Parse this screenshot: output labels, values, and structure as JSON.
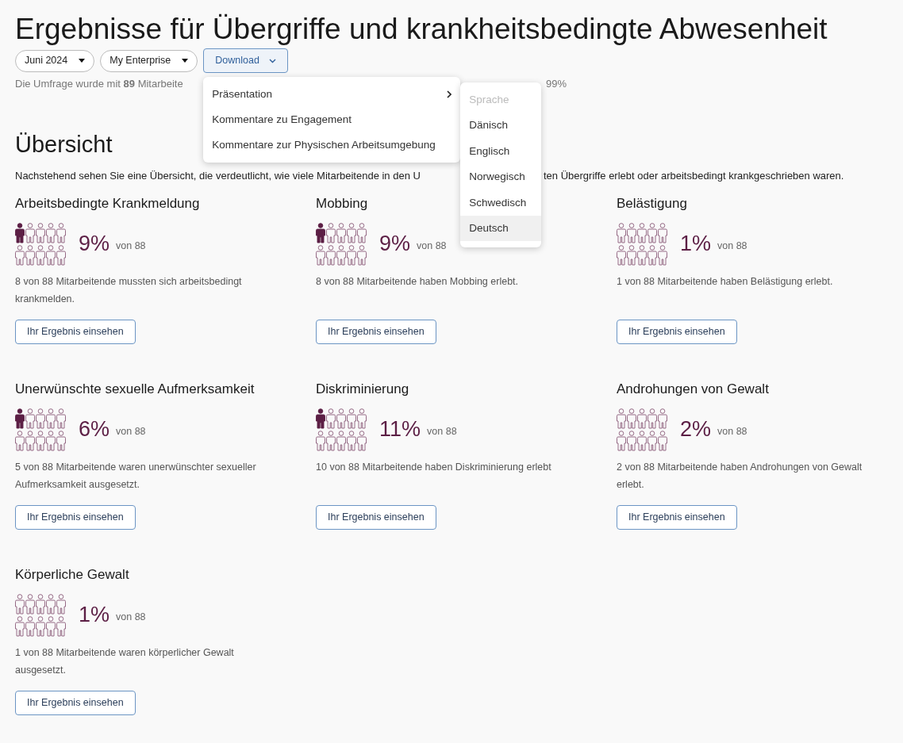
{
  "title": "Ergebnisse für Übergriffe und krankheitsbedingte Abwesenheit",
  "filters": [
    {
      "label": "Juni 2024"
    },
    {
      "label": "My Enterprise"
    }
  ],
  "download": {
    "label": "Download",
    "expanded": true
  },
  "subtitle": {
    "visible_start": "Die Umfrage wurde mit **89** Mitarbeite",
    "visible_end": "99%"
  },
  "download_menu": [
    {
      "label": "Präsentation",
      "kind": "submenu",
      "expanded": true
    },
    {
      "label": "Kommentare zu Engagement",
      "kind": "item"
    },
    {
      "label": "Kommentare zur Physischen Arbeitsumgebung",
      "kind": "item"
    }
  ],
  "language_menu": [
    {
      "label": "Sprache",
      "disabled": true,
      "selected": false
    },
    {
      "label": "Dänisch",
      "disabled": false,
      "selected": false
    },
    {
      "label": "Englisch",
      "disabled": false,
      "selected": false
    },
    {
      "label": "Norwegisch",
      "disabled": false,
      "selected": false
    },
    {
      "label": "Schwedisch",
      "disabled": false,
      "selected": false
    },
    {
      "label": "Deutsch",
      "disabled": false,
      "selected": true
    }
  ],
  "overview": {
    "heading": "Übersicht",
    "description_start": "Nachstehend sehen Sie eine Übersicht, die verdeutlicht, wie viele Mitarbeitende in den U",
    "description_end": "ten Übergriffe erlebt oder arbeitsbedingt krankgeschrieben waren."
  },
  "cards": [
    {
      "title": "Arbeitsbedingte Krankmeldung",
      "figures": [
        {
          "filled": true
        },
        {
          "filled": false
        },
        {
          "filled": false
        },
        {
          "filled": false
        },
        {
          "filled": false
        },
        {
          "filled": false
        },
        {
          "filled": false
        },
        {
          "filled": false
        },
        {
          "filled": false
        },
        {
          "filled": false
        }
      ],
      "percent": "9%",
      "of": "von 88",
      "text": "8 von 88 Mitarbeitende mussten sich arbeitsbedingt krankmelden.",
      "button": "Ihr Ergebnis einsehen"
    },
    {
      "title": "Mobbing",
      "figures": [
        {
          "filled": true
        },
        {
          "filled": false
        },
        {
          "filled": false
        },
        {
          "filled": false
        },
        {
          "filled": false
        },
        {
          "filled": false
        },
        {
          "filled": false
        },
        {
          "filled": false
        },
        {
          "filled": false
        },
        {
          "filled": false
        }
      ],
      "percent": "9%",
      "of": "von 88",
      "text": "8 von 88 Mitarbeitende haben Mobbing erlebt.",
      "button": "Ihr Ergebnis einsehen"
    },
    {
      "title": "Belästigung",
      "figures": [
        {
          "filled": false
        },
        {
          "filled": false
        },
        {
          "filled": false
        },
        {
          "filled": false
        },
        {
          "filled": false
        },
        {
          "filled": false
        },
        {
          "filled": false
        },
        {
          "filled": false
        },
        {
          "filled": false
        },
        {
          "filled": false
        }
      ],
      "percent": "1%",
      "of": "von 88",
      "text": "1 von 88 Mitarbeitende haben Belästigung erlebt.",
      "button": "Ihr Ergebnis einsehen"
    },
    {
      "title": "Unerwünschte sexuelle Aufmerksamkeit",
      "figures": [
        {
          "filled": true
        },
        {
          "filled": false
        },
        {
          "filled": false
        },
        {
          "filled": false
        },
        {
          "filled": false
        },
        {
          "filled": false
        },
        {
          "filled": false
        },
        {
          "filled": false
        },
        {
          "filled": false
        },
        {
          "filled": false
        }
      ],
      "percent": "6%",
      "of": "von 88",
      "text": "5 von 88 Mitarbeitende waren unerwünschter sexueller Aufmerksamkeit ausgesetzt.",
      "button": "Ihr Ergebnis einsehen"
    },
    {
      "title": "Diskriminierung",
      "figures": [
        {
          "filled": true
        },
        {
          "filled": false
        },
        {
          "filled": false
        },
        {
          "filled": false
        },
        {
          "filled": false
        },
        {
          "filled": false
        },
        {
          "filled": false
        },
        {
          "filled": false
        },
        {
          "filled": false
        },
        {
          "filled": false
        }
      ],
      "percent": "11%",
      "of": "von 88",
      "text": "10 von 88 Mitarbeitende haben Diskriminierung erlebt",
      "button": "Ihr Ergebnis einsehen"
    },
    {
      "title": "Androhungen von Gewalt",
      "figures": [
        {
          "filled": false
        },
        {
          "filled": false
        },
        {
          "filled": false
        },
        {
          "filled": false
        },
        {
          "filled": false
        },
        {
          "filled": false
        },
        {
          "filled": false
        },
        {
          "filled": false
        },
        {
          "filled": false
        },
        {
          "filled": false
        }
      ],
      "percent": "2%",
      "of": "von 88",
      "text": "2 von 88 Mitarbeitende haben Androhungen von Gewalt erlebt.",
      "button": "Ihr Ergebnis einsehen"
    },
    {
      "title": "Körperliche Gewalt",
      "figures": [
        {
          "filled": false
        },
        {
          "filled": false
        },
        {
          "filled": false
        },
        {
          "filled": false
        },
        {
          "filled": false
        },
        {
          "filled": false
        },
        {
          "filled": false
        },
        {
          "filled": false
        },
        {
          "filled": false
        },
        {
          "filled": false
        }
      ],
      "percent": "1%",
      "of": "von 88",
      "text": "1 von 88 Mitarbeitende waren körperlicher Gewalt ausgesetzt.",
      "button": "Ihr Ergebnis einsehen"
    }
  ]
}
